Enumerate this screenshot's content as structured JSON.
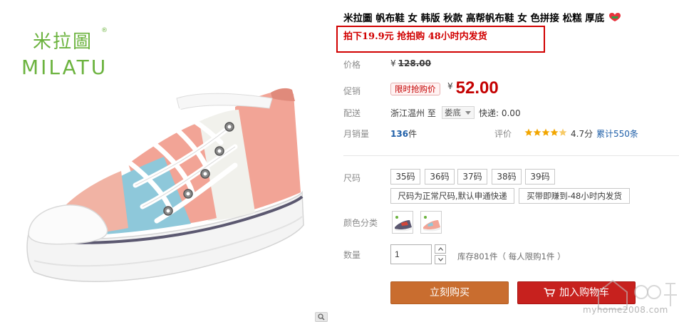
{
  "brand": {
    "logo_cn": "米拉圖",
    "logo_en": "MILATU",
    "logo_reg": "®"
  },
  "product": {
    "title": "米拉圖 帆布鞋 女 韩版 秋款 高帮帆布鞋 女 色拼接 松糕 厚底",
    "promo_text": "拍下19.9元 抢拍购 48小时内发货"
  },
  "price": {
    "label": "价格",
    "currency": "¥",
    "original": "128.00"
  },
  "promotion": {
    "label": "促销",
    "tag": "限时抢购价",
    "currency": "¥",
    "value": "52.00"
  },
  "shipping": {
    "label": "配送",
    "origin": "浙江温州",
    "to_word": "至",
    "destination": "娄底",
    "fee": "快递: 0.00"
  },
  "sales": {
    "label": "月销量",
    "count": "136",
    "unit": "件",
    "review_label": "评价",
    "rating": 4.7,
    "rating_text": "4.7分",
    "review_count": "累计550条"
  },
  "size": {
    "label": "尺码",
    "options": [
      "35码",
      "36码",
      "37码",
      "38码",
      "39码"
    ],
    "notes": [
      "尺码为正常尺码,默认申通快递",
      "买带即赚到-48小时内发货"
    ]
  },
  "color": {
    "label": "颜色分类"
  },
  "quantity": {
    "label": "数量",
    "value": "1",
    "stock": "库存801件（ 每人限购1件 ）"
  },
  "actions": {
    "buy_now": "立刻购买",
    "add_to_cart": "加入购物车"
  },
  "watermark": {
    "url": "myhome2008.com"
  },
  "colors": {
    "accent_red": "#c40000",
    "buy_orange": "#c96d2f",
    "cart_red": "#c7211e",
    "brand_green": "#6cb33f",
    "link_blue": "#1f5fa8"
  }
}
